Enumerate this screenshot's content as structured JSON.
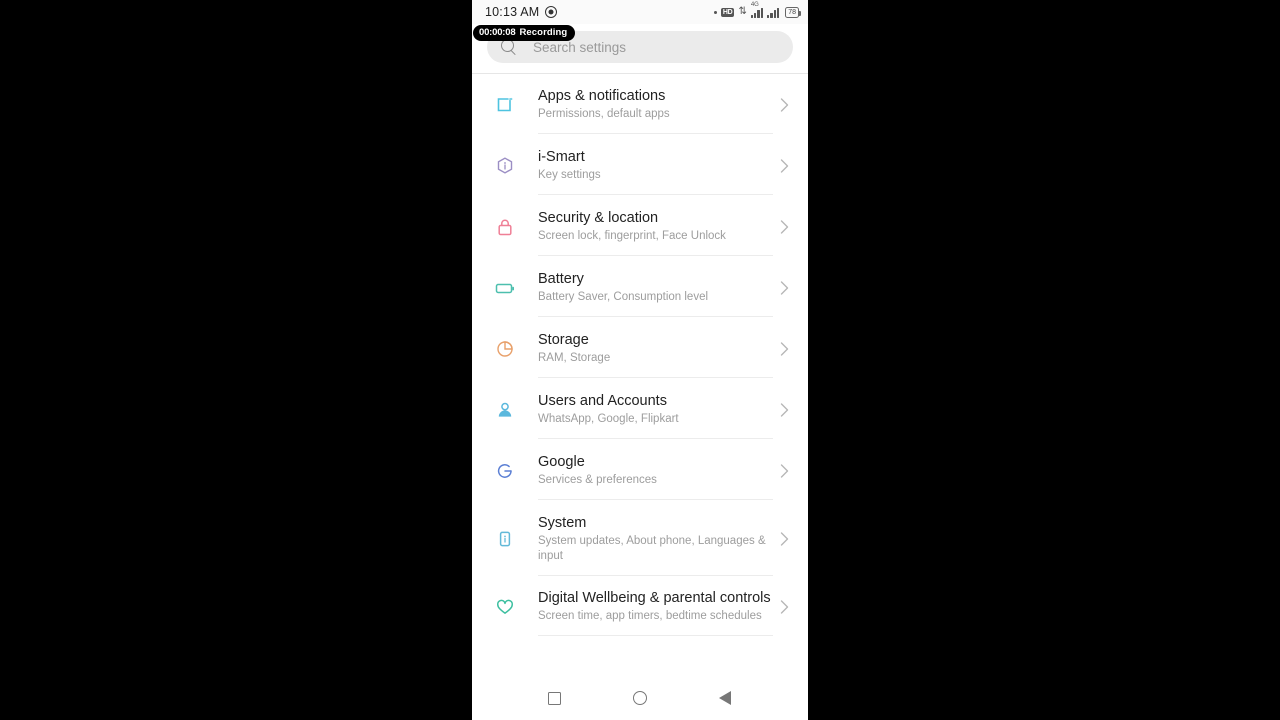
{
  "statusbar": {
    "time": "10:13 AM",
    "record_indicator_icon": "record-dot-icon",
    "dot_icon": "dot-icon",
    "hd_label": "HD",
    "data_arrows": "⇅",
    "network_label": "4G",
    "battery_level": "78"
  },
  "recording_badge": {
    "elapsed": "00:00:08",
    "label": "Recording"
  },
  "search": {
    "placeholder": "Search settings",
    "icon": "search-icon"
  },
  "settings": {
    "items": [
      {
        "title": "Apps & notifications",
        "subtitle": "Permissions, default apps",
        "icon": "apps-icon",
        "icon_color": "#4ec3e0"
      },
      {
        "title": "i-Smart",
        "subtitle": "Key settings",
        "icon": "ismart-hexagon-icon",
        "icon_color": "#9b8ec4"
      },
      {
        "title": "Security & location",
        "subtitle": "Screen lock, fingerprint, Face Unlock",
        "icon": "lock-icon",
        "icon_color": "#ef7f96"
      },
      {
        "title": "Battery",
        "subtitle": "Battery Saver, Consumption level",
        "icon": "battery-icon",
        "icon_color": "#4dbfae"
      },
      {
        "title": "Storage",
        "subtitle": "RAM, Storage",
        "icon": "storage-pie-icon",
        "icon_color": "#e8a06a"
      },
      {
        "title": "Users and Accounts",
        "subtitle": "WhatsApp, Google, Flipkart",
        "icon": "user-account-icon",
        "icon_color": "#5bb8dd"
      },
      {
        "title": "Google",
        "subtitle": "Services & preferences",
        "icon": "google-g-icon",
        "icon_color": "#5b7fd4"
      },
      {
        "title": "System",
        "subtitle": "System updates, About phone, Languages & input",
        "icon": "system-info-icon",
        "icon_color": "#63b9d8"
      },
      {
        "title": "Digital Wellbeing & parental controls",
        "subtitle": "Screen time, app timers, bedtime schedules",
        "icon": "heart-icon",
        "icon_color": "#3dbfa0"
      }
    ],
    "chevron_icon": "chevron-right-icon"
  },
  "navbar": {
    "recents_label": "recents-square",
    "home_label": "home-circle",
    "back_label": "back-triangle"
  }
}
